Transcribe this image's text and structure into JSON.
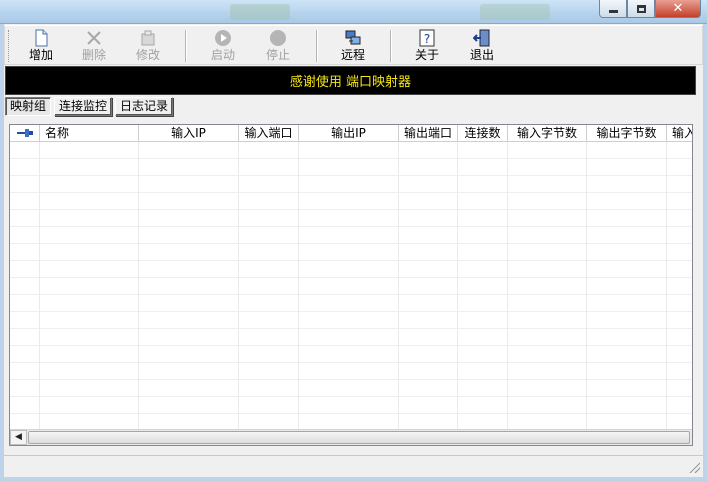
{
  "window": {
    "controls": [
      "minimize-icon",
      "maximize-icon",
      "close-icon"
    ]
  },
  "toolbar": {
    "buttons": [
      {
        "label": "增加",
        "icon": "add-document-icon",
        "enabled": true
      },
      {
        "label": "删除",
        "icon": "delete-x-icon",
        "enabled": false
      },
      {
        "label": "修改",
        "icon": "edit-icon",
        "enabled": false
      },
      {
        "label": "启动",
        "icon": "play-icon",
        "enabled": false
      },
      {
        "label": "停止",
        "icon": "stop-icon",
        "enabled": false
      },
      {
        "label": "远程",
        "icon": "remote-computer-icon",
        "enabled": true
      },
      {
        "label": "关于",
        "icon": "help-icon",
        "enabled": true
      },
      {
        "label": "退出",
        "icon": "exit-door-icon",
        "enabled": true
      }
    ]
  },
  "banner": {
    "text": "感谢使用 端口映射器",
    "text_color": "#f5e616",
    "background": "#000000"
  },
  "tabs": [
    {
      "label": "映射组",
      "active": true
    },
    {
      "label": "连接监控",
      "active": false
    },
    {
      "label": "日志记录",
      "active": false
    }
  ],
  "table": {
    "pin_icon": "pin-icon",
    "columns": [
      "名称",
      "输入IP",
      "输入端口",
      "输出IP",
      "输出端口",
      "连接数",
      "输入字节数",
      "输出字节数",
      "输入"
    ],
    "rows": []
  }
}
